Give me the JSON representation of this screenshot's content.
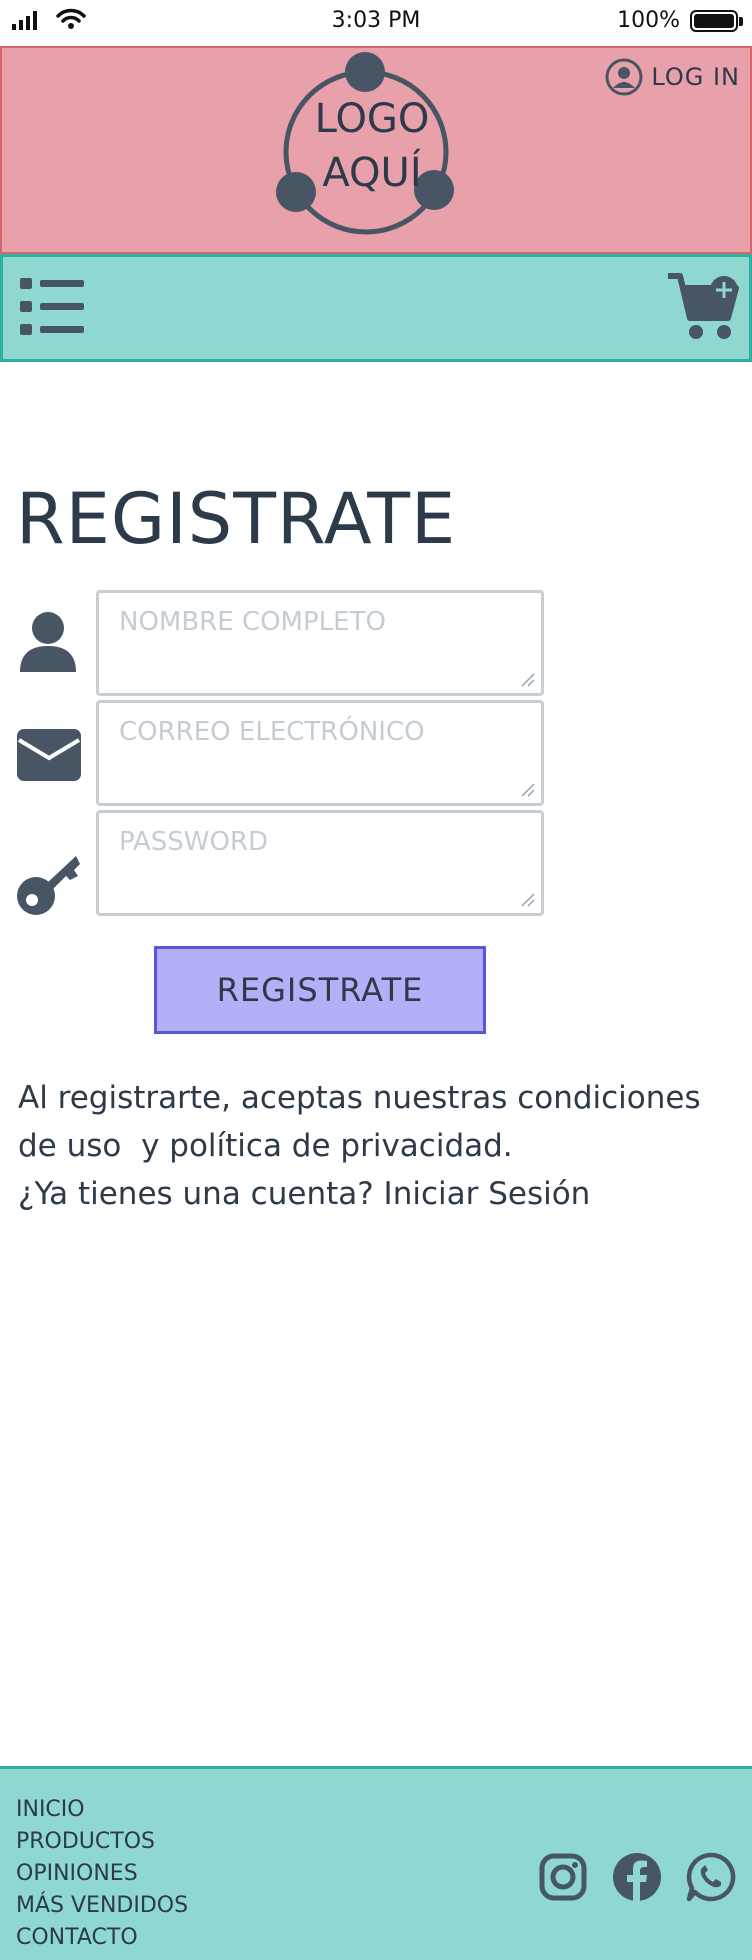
{
  "status_bar": {
    "time": "3:03 PM",
    "battery": "100%",
    "battery_level": 1.0
  },
  "header": {
    "logo_line1": "LOGO",
    "logo_line2": "AQUÍ",
    "login_label": "LOG IN"
  },
  "register": {
    "title": "REGISTRATE",
    "fields": [
      {
        "icon": "user-icon",
        "placeholder": "NOMBRE COMPLETO"
      },
      {
        "icon": "envelope-icon",
        "placeholder": "CORREO ELECTRÓNICO"
      },
      {
        "icon": "key-icon",
        "placeholder": "PASSWORD"
      }
    ],
    "submit_label": "REGISTRATE",
    "terms_line1": "Al registrarte, aceptas nuestras condiciones",
    "terms_line2": "de uso  y política de privacidad.",
    "login_prompt": "¿Ya tienes una cuenta? Iniciar Sesión"
  },
  "footer": {
    "links": [
      "INICIO",
      "PRODUCTOS",
      "OPINIONES",
      "MÁS VENDIDOS",
      "CONTACTO"
    ],
    "social_icons": [
      "instagram-icon",
      "facebook-icon",
      "whatsapp-icon"
    ]
  },
  "colors": {
    "header_bg": "#e8a0ab",
    "header_border": "#d9626f",
    "nav_bg": "#8fd8cf",
    "nav_border": "#2eaf9f",
    "button_bg": "#b3b0f7",
    "button_border": "#5a55dd",
    "text": "#2c3a4a",
    "icon": "#475565"
  }
}
